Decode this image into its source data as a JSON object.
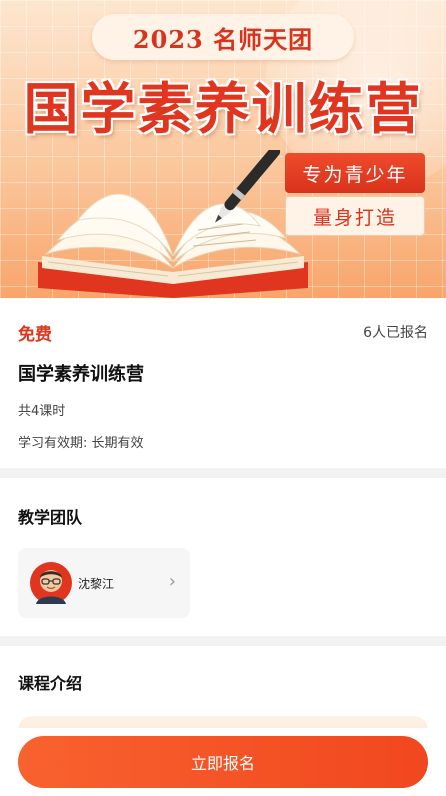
{
  "banner": {
    "year_label": "2023 名师天团",
    "title": "国学素养训练营",
    "tag_primary": "专为青少年",
    "tag_secondary": "量身打造"
  },
  "course": {
    "price_label": "免费",
    "enrolled_count": "6人已报名",
    "title": "国学素养训练营",
    "lessons": "共4课时",
    "validity": "学习有效期: 长期有效"
  },
  "team": {
    "section_title": "教学团队",
    "teachers": [
      {
        "name": "沈黎江"
      }
    ]
  },
  "intro": {
    "section_title": "课程介绍"
  },
  "actions": {
    "signup_label": "立即报名"
  },
  "colors": {
    "accent": "#e0361f",
    "button": "#f4512a",
    "page_background": "#f2f2f2"
  }
}
